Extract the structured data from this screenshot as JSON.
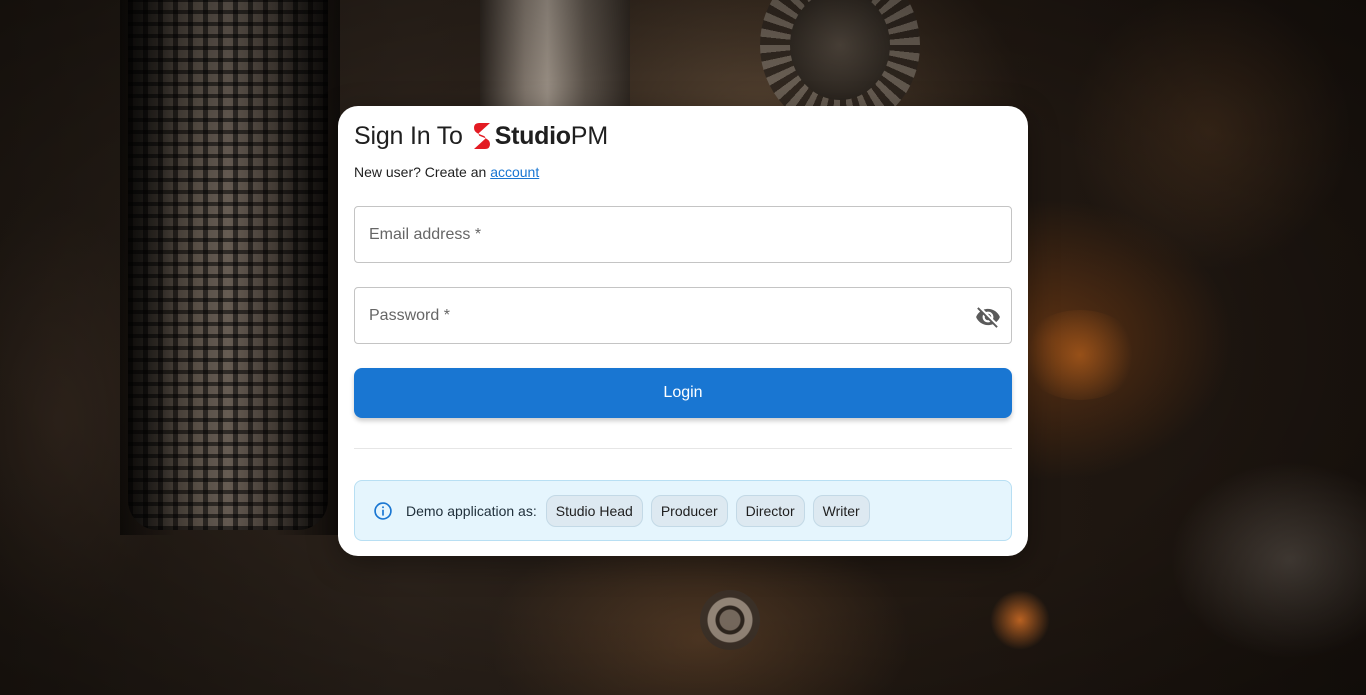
{
  "header": {
    "title_prefix": "Sign In To",
    "logo_strong": "Studio",
    "logo_light": "PM"
  },
  "subtitle": {
    "text": "New user? Create an",
    "link": "account"
  },
  "form": {
    "email_placeholder": "Email address *",
    "password_placeholder": "Password *",
    "login_label": "Login"
  },
  "demo": {
    "label": "Demo application as:",
    "roles": [
      "Studio Head",
      "Producer",
      "Director",
      "Writer"
    ]
  },
  "icons": {
    "logo": "studiopm-s-logo-icon",
    "password_toggle": "eye-off-icon",
    "info": "info-icon"
  },
  "colors": {
    "accent": "#1976d2",
    "logo_red": "#e31b23",
    "demo_bg": "#e5f5fd"
  }
}
